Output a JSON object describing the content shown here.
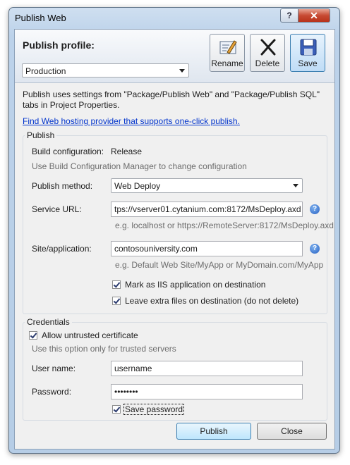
{
  "window": {
    "title": "Publish Web"
  },
  "titlebar": {
    "help_label": "?",
    "close_label": "✕"
  },
  "header": {
    "profile_label": "Publish profile:",
    "profile_value": "Production",
    "rename_label": "Rename",
    "delete_label": "Delete",
    "save_label": "Save"
  },
  "info": {
    "text": "Publish uses settings from \"Package/Publish Web\" and \"Package/Publish SQL\" tabs in Project Properties.",
    "link": "Find Web hosting provider that supports one-click publish."
  },
  "publish": {
    "group_title": "Publish",
    "build_label": "Build configuration:",
    "build_value": "Release",
    "build_hint": "Use Build Configuration Manager to change configuration",
    "method_label": "Publish method:",
    "method_value": "Web Deploy",
    "service_url_label": "Service URL:",
    "service_url_value": "tps://vserver01.cytanium.com:8172/MsDeploy.axd",
    "service_url_hint": "e.g. localhost or https://RemoteServer:8172/MsDeploy.axd",
    "site_label": "Site/application:",
    "site_value": "contosouniversity.com",
    "site_hint": "e.g. Default Web Site/MyApp or MyDomain.com/MyApp",
    "mark_iis_label": "Mark as IIS application on destination",
    "mark_iis_checked": true,
    "leave_files_label": "Leave extra files on destination (do not delete)",
    "leave_files_checked": true
  },
  "credentials": {
    "group_title": "Credentials",
    "allow_untrusted_label": "Allow untrusted certificate",
    "allow_untrusted_checked": true,
    "allow_untrusted_hint": "Use this option only for trusted servers",
    "username_label": "User name:",
    "username_value": "username",
    "password_label": "Password:",
    "password_value": "••••••••",
    "save_password_label": "Save password",
    "save_password_checked": true
  },
  "footer": {
    "publish_label": "Publish",
    "close_label": "Close"
  },
  "icons": {
    "help": "question-circle-icon",
    "rename": "rename-icon",
    "delete": "delete-x-icon",
    "save": "floppy-disk-icon"
  }
}
